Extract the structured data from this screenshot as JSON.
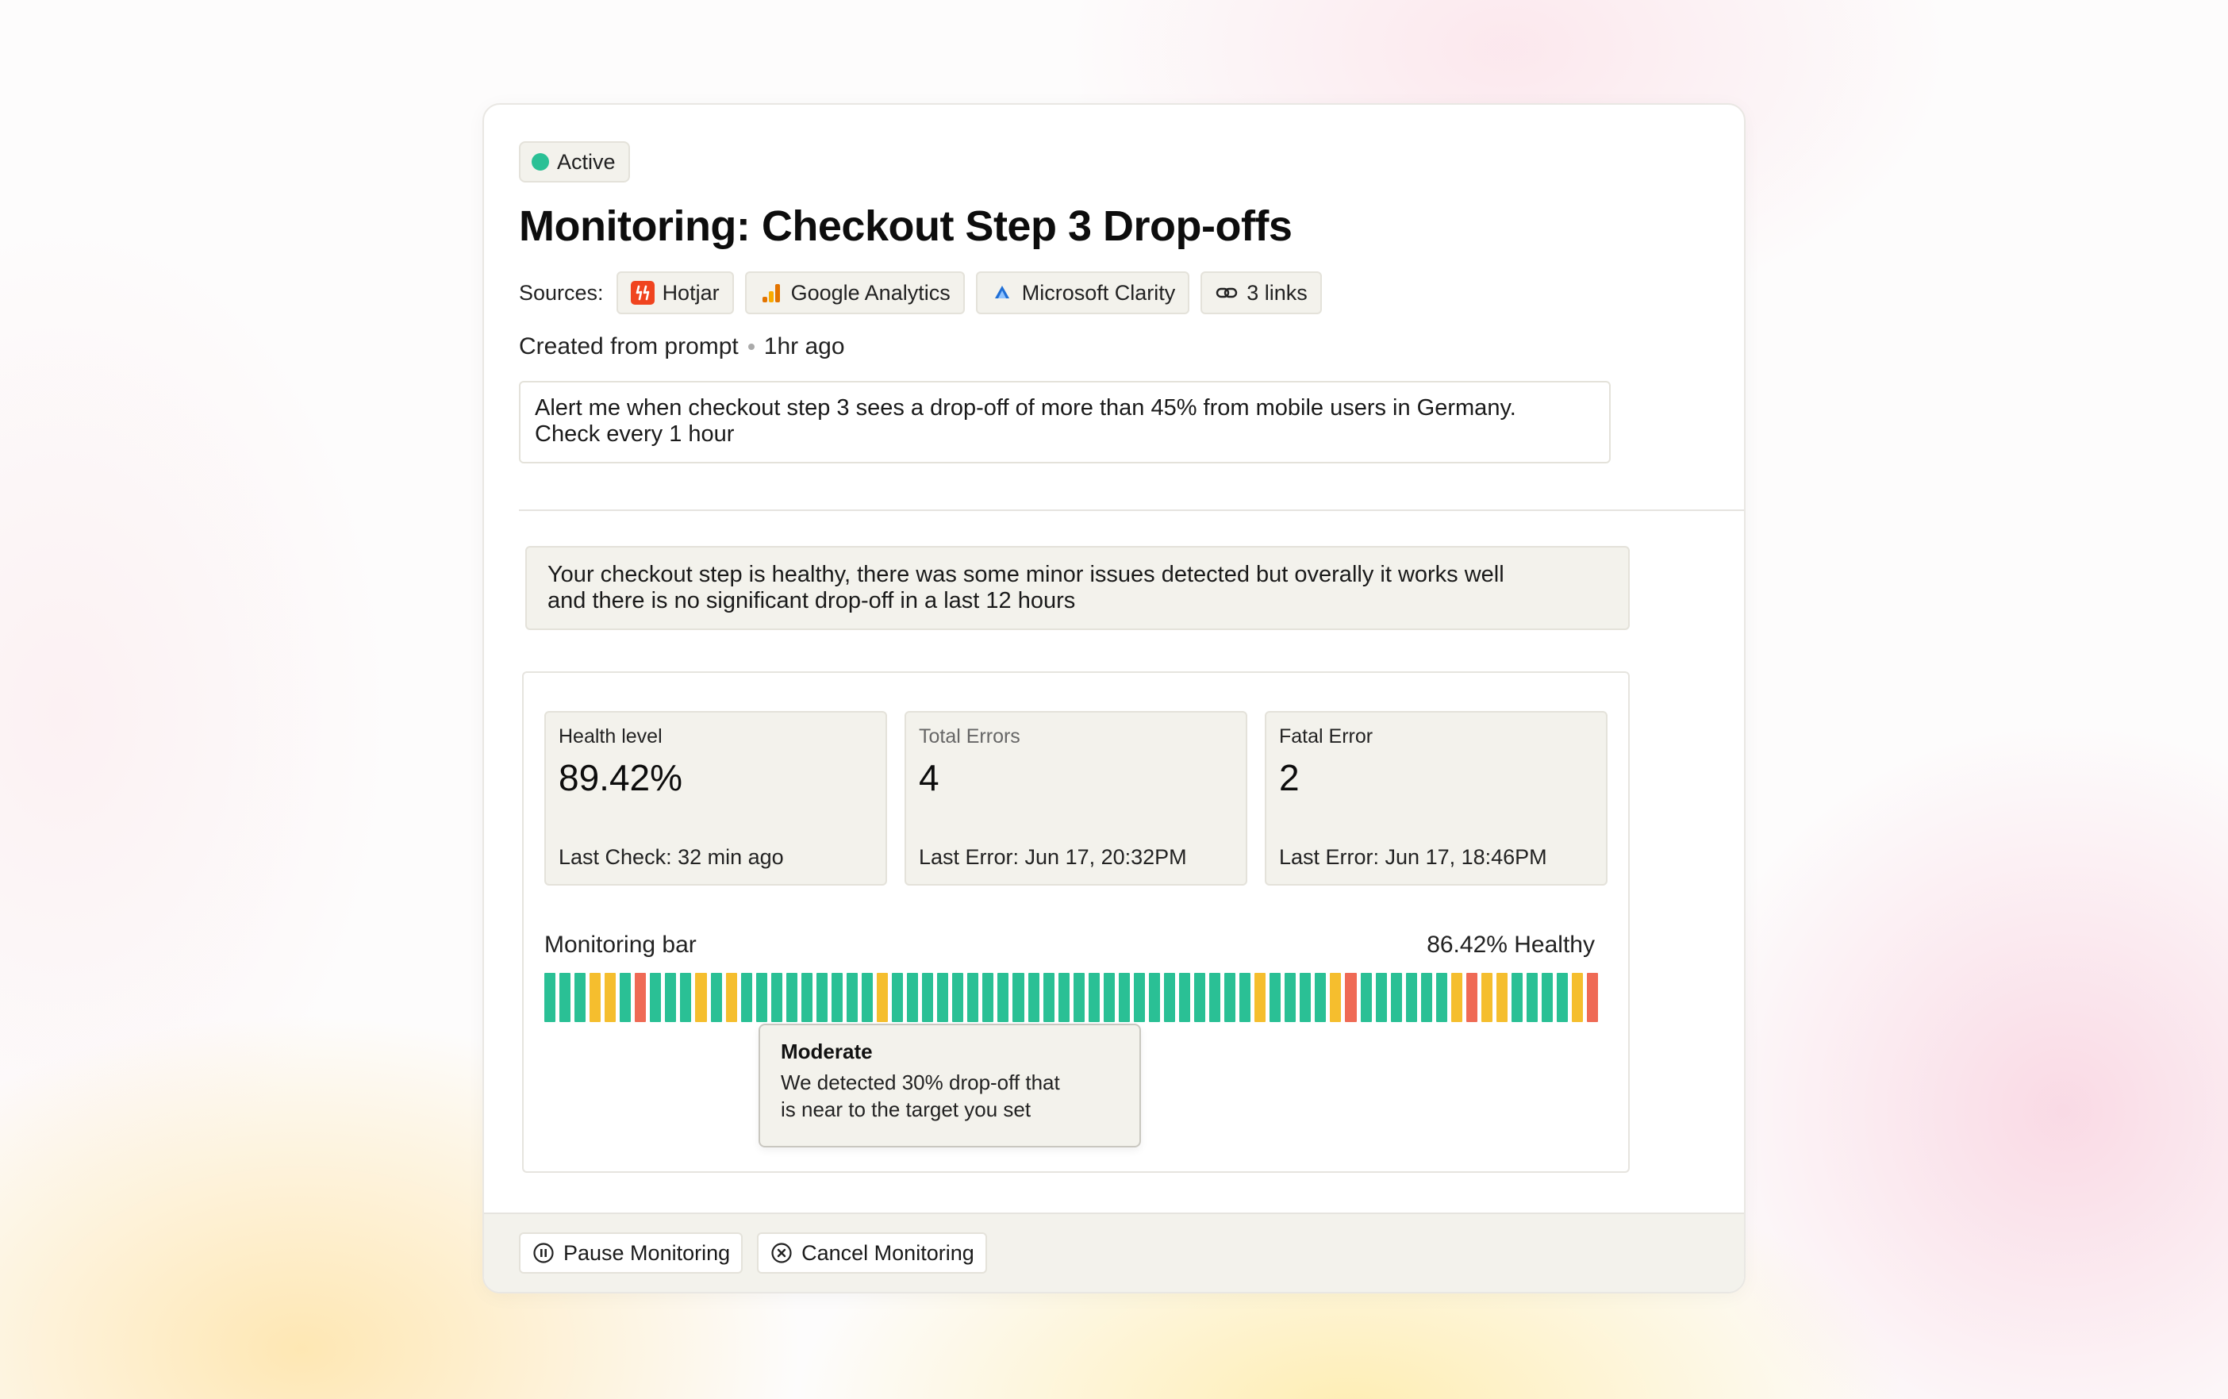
{
  "status": {
    "label": "Active",
    "color": "#2ac095"
  },
  "title": "Monitoring: Checkout Step 3 Drop-offs",
  "sources": {
    "label": "Sources:",
    "items": [
      {
        "label": "Hotjar",
        "icon": "hotjar-icon"
      },
      {
        "label": "Google Analytics",
        "icon": "google-analytics-icon"
      },
      {
        "label": "Microsoft Clarity",
        "icon": "microsoft-clarity-icon"
      },
      {
        "label": "3 links",
        "icon": "link-icon"
      }
    ]
  },
  "meta": {
    "created": "Created from prompt",
    "time": "1hr ago"
  },
  "prompt": {
    "line1": "Alert me when checkout step 3 sees a drop-off of more than 45%  from mobile users in Germany.",
    "line2": "Check every  1 hour"
  },
  "summary": {
    "line1": "Your checkout step is healthy, there was some minor issues detected but overally it works well",
    "line2": "and there is no significant drop-off in a last 12 hours"
  },
  "stats": [
    {
      "label": "Health level",
      "value": "89.42%",
      "foot": "Last Check: 32 min ago"
    },
    {
      "label": "Total Errors",
      "value": "4",
      "foot": "Last Error: Jun 17, 20:32PM"
    },
    {
      "label": "Fatal Error",
      "value": "2",
      "foot": "Last Error: Jun 17, 18:46PM"
    }
  ],
  "monitoring_bar": {
    "label": "Monitoring bar",
    "health": "86.42% Healthy",
    "colors": {
      "g": "#2ac095",
      "y": "#f5be2e",
      "r": "#ef6a55"
    },
    "segments": "gggyygrgggygygggggggggyggggggggggggggggggggggggyggggyrggggggyryyggggyr"
  },
  "tooltip": {
    "title": "Moderate",
    "line1": "We detected 30% drop-off that",
    "line2": "is near to the target you set"
  },
  "actions": {
    "pause": "Pause Monitoring",
    "cancel": "Cancel Monitoring"
  }
}
